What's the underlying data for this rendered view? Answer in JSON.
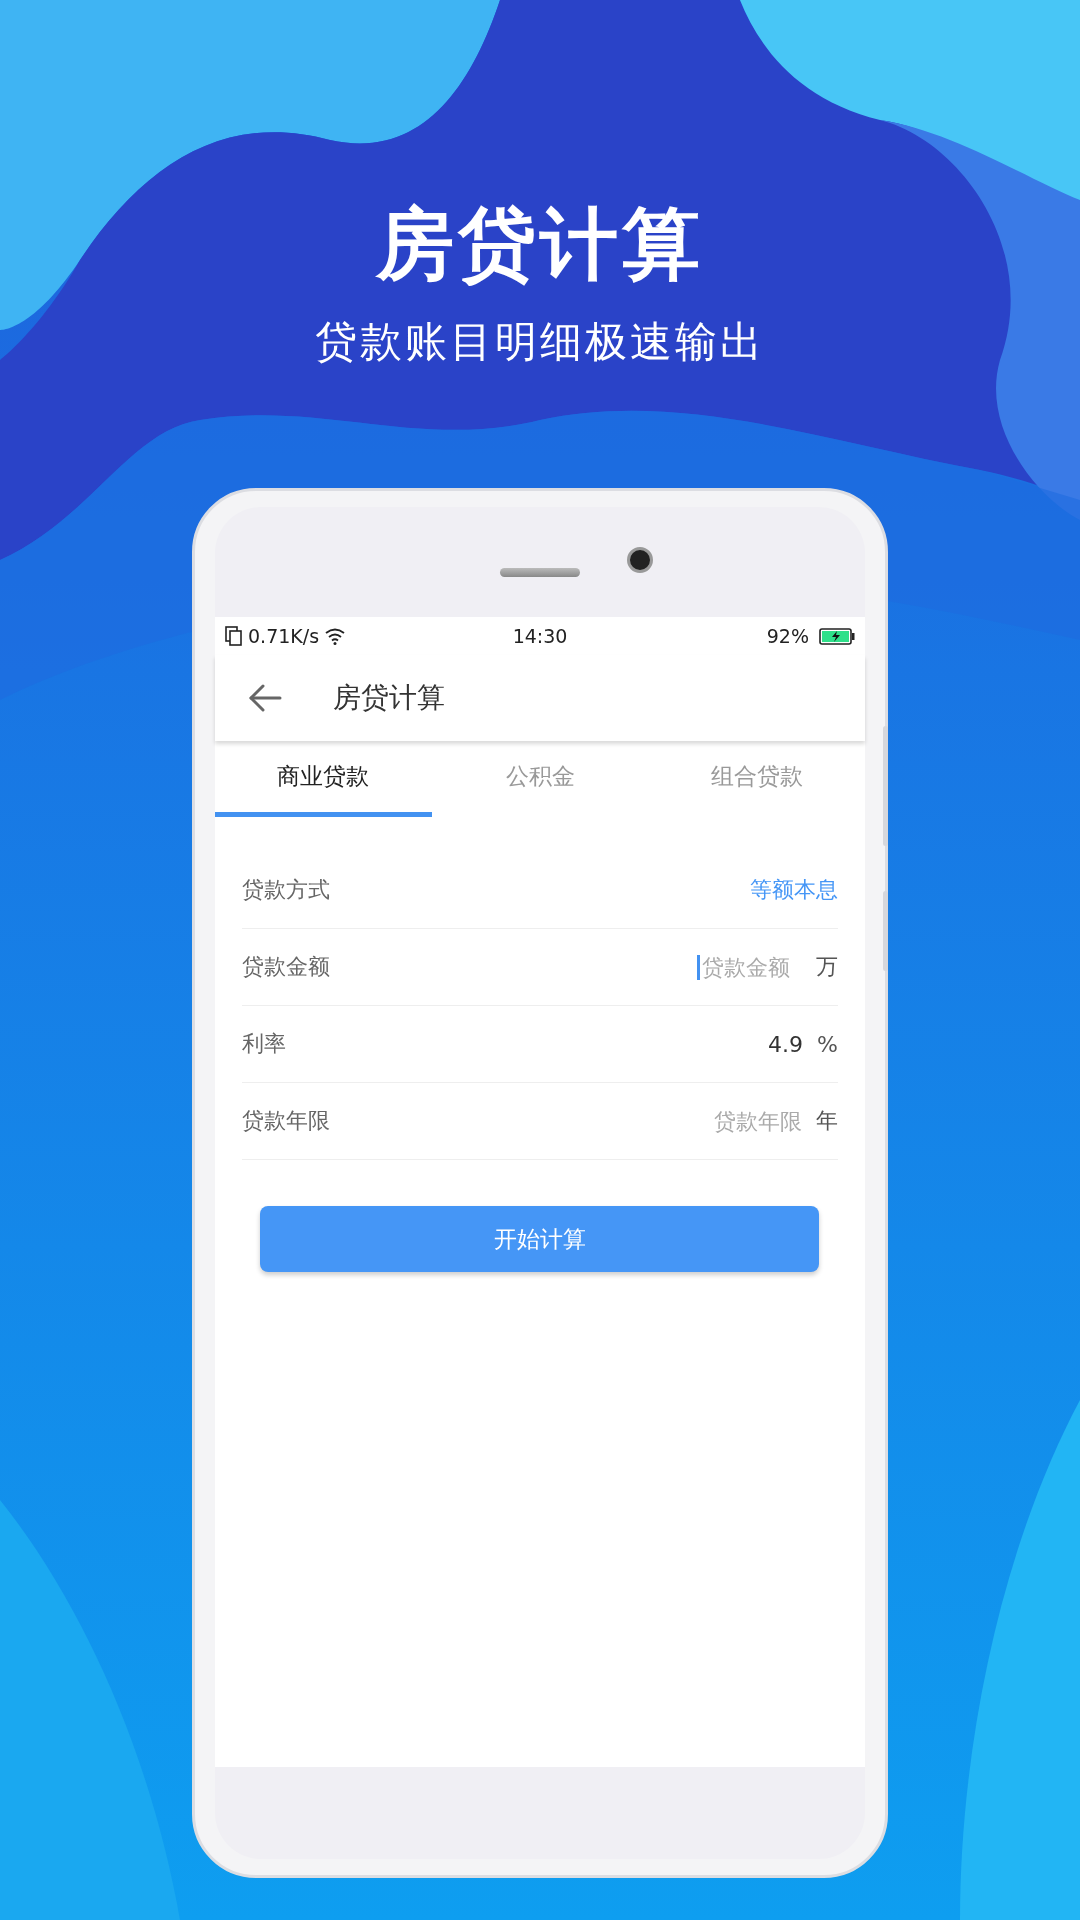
{
  "promo": {
    "title": "房贷计算",
    "subtitle": "贷款账目明细极速输出"
  },
  "status_bar": {
    "speed": "0.71K/s",
    "time": "14:30",
    "battery": "92%"
  },
  "app_bar": {
    "title": "房贷计算"
  },
  "tabs": [
    {
      "label": "商业贷款",
      "selected": true
    },
    {
      "label": "公积金",
      "selected": false
    },
    {
      "label": "组合贷款",
      "selected": false
    }
  ],
  "form": {
    "rows": [
      {
        "kind": "select",
        "label": "贷款方式",
        "value": "等额本息"
      },
      {
        "kind": "input",
        "label": "贷款金额",
        "placeholder": "贷款金额",
        "unit": "万",
        "focused": true
      },
      {
        "kind": "input",
        "label": "利率",
        "value": "4.9",
        "unit": "%",
        "focused": false
      },
      {
        "kind": "input",
        "label": "贷款年限",
        "placeholder": "贷款年限",
        "unit": "年",
        "focused": false
      }
    ]
  },
  "button": "开始计算"
}
